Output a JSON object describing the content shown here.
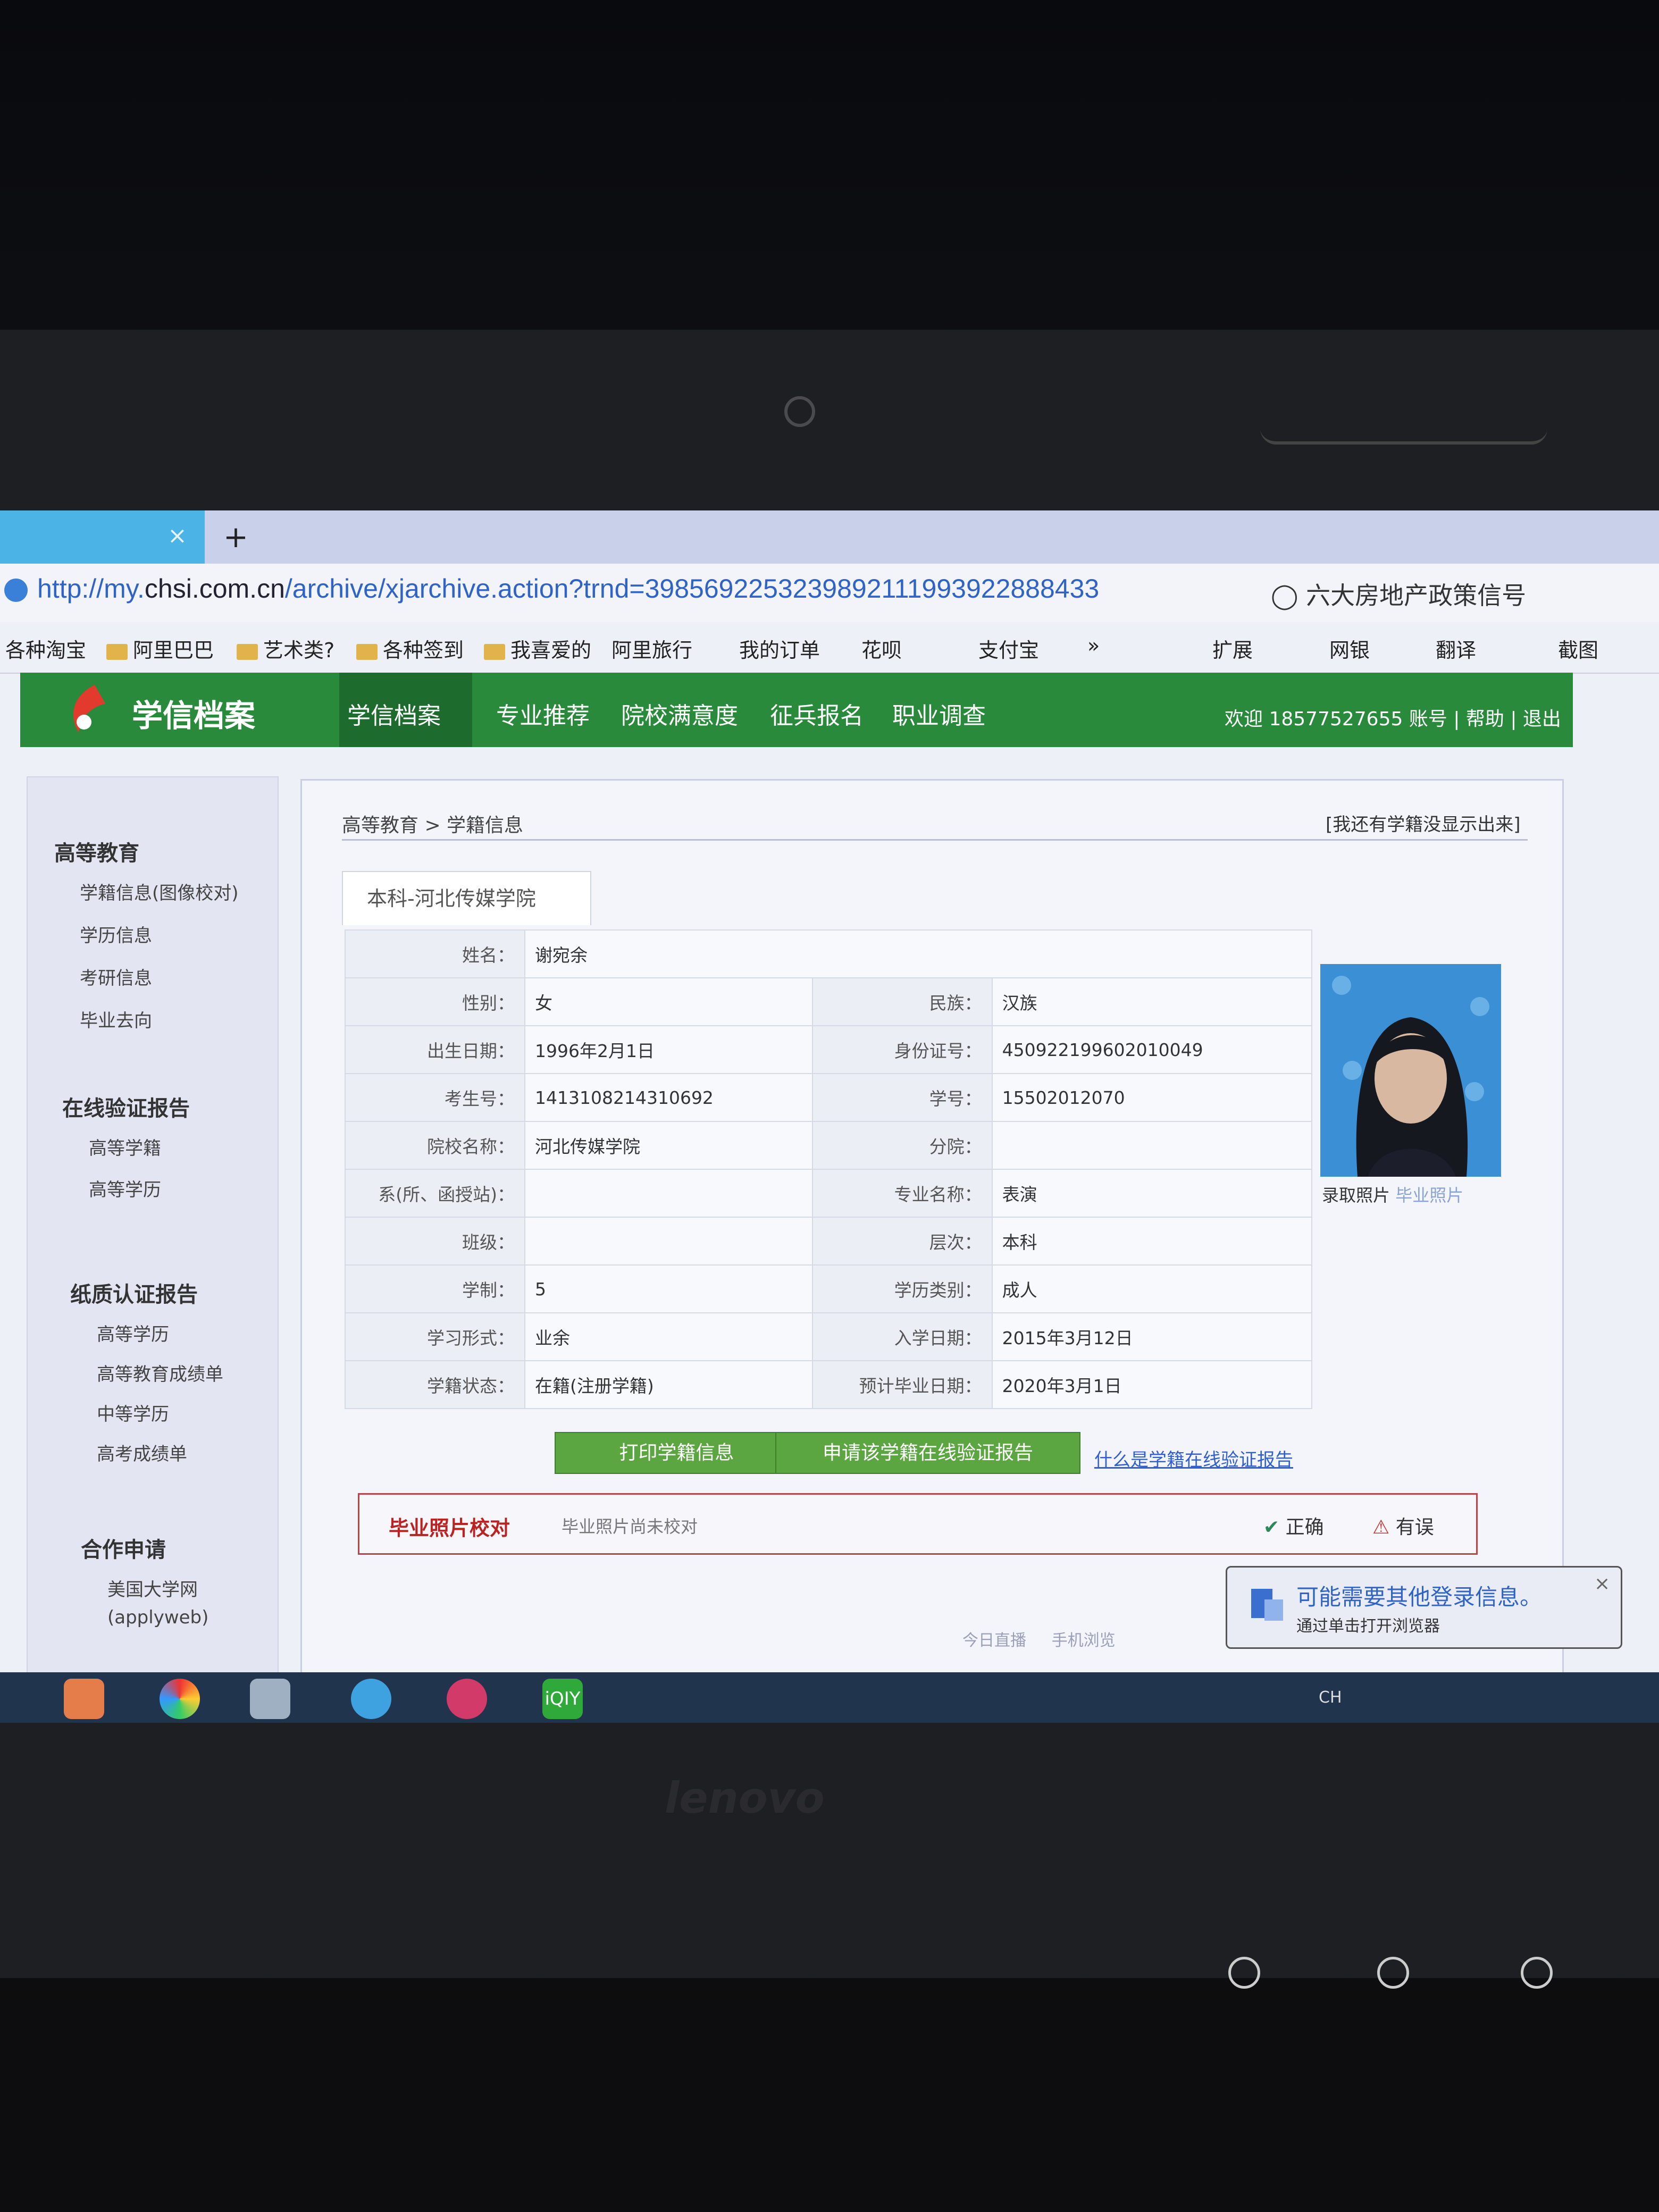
{
  "browser": {
    "tab_close_glyph": "×",
    "new_tab_glyph": "+",
    "url_prefix": "http://my.",
    "url_domain": "chsi.com.cn",
    "url_path": "/archive/xjarchive.action?trnd=3985692253239892111993922888433",
    "search_text": "六大房地产政策信号",
    "bookmarks": [
      "各种淘宝",
      "阿里巴巴",
      "艺术类?",
      "各种签到",
      "我喜爱的",
      "阿里旅行",
      "我的订单",
      "花呗",
      "支付宝",
      "»"
    ],
    "toolbar_items": [
      "扩展",
      "网银",
      "翻译",
      "截图"
    ]
  },
  "site": {
    "logo": "学信档案",
    "nav": [
      "学信档案",
      "专业推荐",
      "院校满意度",
      "征兵报名",
      "职业调查"
    ],
    "welcome": "欢迎 18577527655 账号",
    "help": "帮助",
    "logout": "退出"
  },
  "sidebar": {
    "sections": [
      {
        "title": "高等教育",
        "items": [
          "学籍信息(图像校对)",
          "学历信息",
          "考研信息",
          "毕业去向"
        ]
      },
      {
        "title": "在线验证报告",
        "items": [
          "高等学籍",
          "高等学历"
        ]
      },
      {
        "title": "纸质认证报告",
        "items": [
          "高等学历",
          "高等教育成绩单",
          "中等学历",
          "高考成绩单"
        ]
      },
      {
        "title": "合作申请",
        "items": [
          "美国大学网",
          "(applyweb)"
        ]
      }
    ]
  },
  "main": {
    "breadcrumb": "高等教育 > 学籍信息",
    "not_shown_link": "[我还有学籍没显示出来]",
    "school_tab": "本科-河北传媒学院",
    "fields": {
      "name_label": "姓名：",
      "name": "谢宛余",
      "gender_label": "性别：",
      "gender": "女",
      "ethnicity_label": "民族：",
      "ethnicity": "汉族",
      "birth_label": "出生日期：",
      "birth": "1996年2月1日",
      "id_label": "身份证号：",
      "id": "450922199602010049",
      "exam_no_label": "考生号：",
      "exam_no": "1413108214310692",
      "student_no_label": "学号：",
      "student_no": "15502012070",
      "school_label": "院校名称：",
      "school": "河北传媒学院",
      "branch_label": "分院：",
      "branch": "",
      "dept_label": "系(所、函授站)：",
      "dept": "",
      "major_label": "专业名称：",
      "major": "表演",
      "class_label": "班级：",
      "class": "",
      "level_label": "层次：",
      "level": "本科",
      "years_label": "学制：",
      "years": "5",
      "category_label": "学历类别：",
      "category": "成人",
      "study_form_label": "学习形式：",
      "study_form": "业余",
      "entry_label": "入学日期：",
      "entry": "2015年3月12日",
      "status_label": "学籍状态：",
      "status": "在籍(注册学籍)",
      "grad_label": "预计毕业日期：",
      "grad": "2020年3月1日"
    },
    "photo_admission": "录取照片",
    "photo_graduation": "毕业照片",
    "print_button": "打印学籍信息",
    "apply_button": "申请该学籍在线验证报告",
    "what_link": "什么是学籍在线验证报告",
    "photo_check_title": "毕业照片校对",
    "photo_check_status": "毕业照片尚未校对",
    "correct": "正确",
    "error": "有误",
    "bottom_links": [
      "今日直播",
      "手机浏览"
    ]
  },
  "notification": {
    "title": "可能需要其他登录信息。",
    "subtitle": "通过单击打开浏览器",
    "close": "×"
  },
  "taskbar": {
    "lang": "CH",
    "iqiyi": "iQIY"
  },
  "laptop_brand": "lenovo",
  "colors": {
    "header_green": "#2a8a3c",
    "button_green": "#5ca641",
    "link_blue": "#2f5fd0",
    "alert_red": "#b22222"
  }
}
